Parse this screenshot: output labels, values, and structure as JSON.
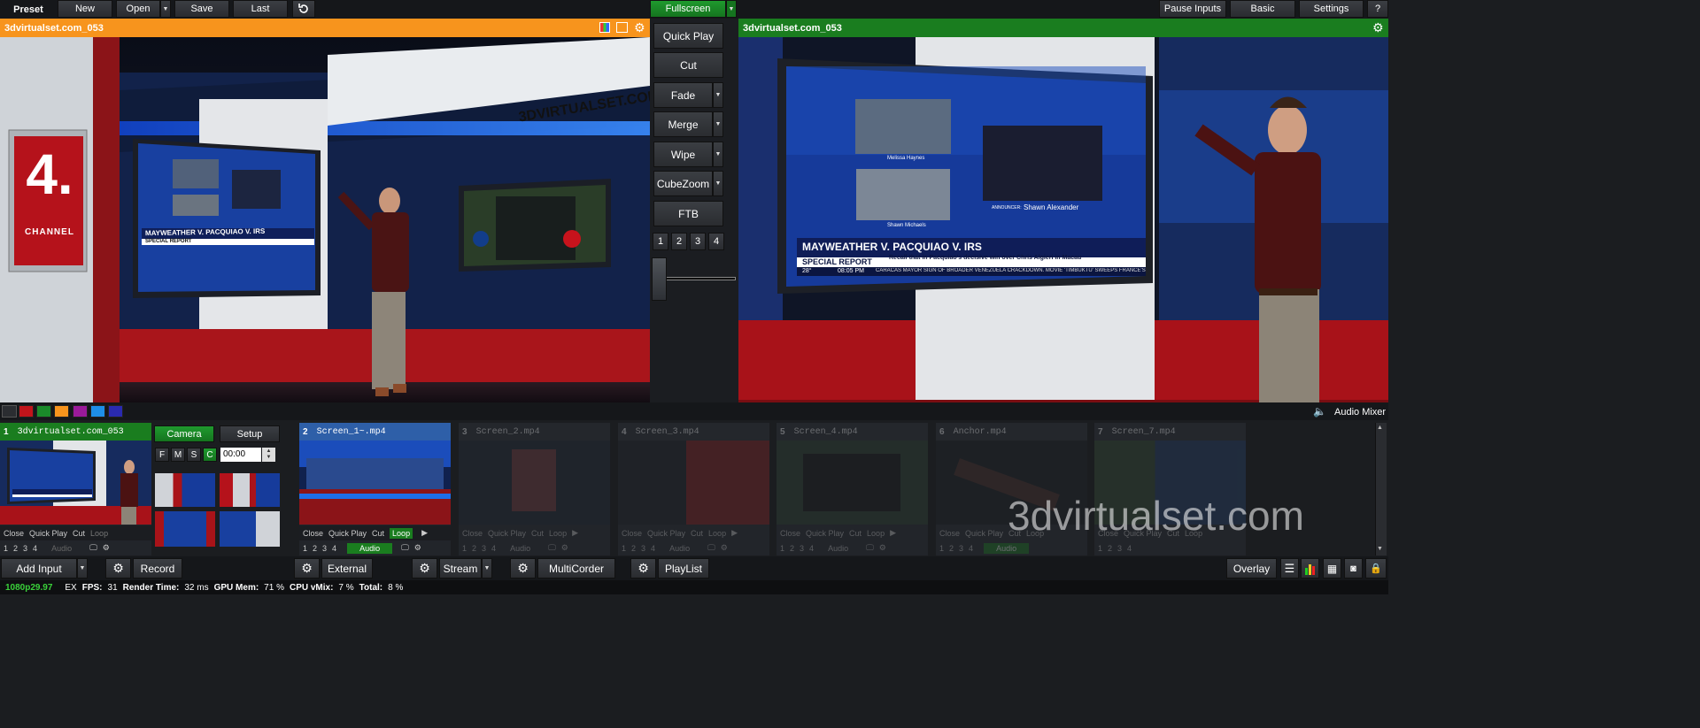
{
  "toolbar": {
    "preset_label": "Preset",
    "new_label": "New",
    "open_label": "Open",
    "save_label": "Save",
    "last_label": "Last",
    "fullscreen_label": "Fullscreen",
    "pause_inputs_label": "Pause Inputs",
    "basic_label": "Basic",
    "settings_label": "Settings",
    "help_label": "?"
  },
  "preview": {
    "title": "3dvirtualset.com_053",
    "header_color": "#f7941d",
    "brand_text": "3DVIRTUALSET.COM",
    "channel_number": "4.",
    "channel_word": "CHANNEL",
    "lower_third": "MAYWEATHER V. PACQUIAO V. IRS",
    "special_report": "SPECIAL REPORT"
  },
  "program": {
    "title": "3dvirtualset.com_053",
    "header_color": "#1a7d1f",
    "headline": "MAYWEATHER V. PACQUIAO V. IRS",
    "special_report": "SPECIAL REPORT",
    "ticker_main": "Recall that in Pacquiao's decisive win over Chris Algieri in Macau",
    "ticker_small": "CARACAS MAYOR SIGN OF BROADER VENEZUELA CRACKDOWN.   MOVIE 'TIMBUKTU' SWEEPS FRANCE'S CESAR AWARDS",
    "temp": "28°",
    "time": "08:05 PM",
    "reporter1": "Melissa Haynes",
    "reporter2": "Shawn Michaels",
    "announcer": "Shawn Alexander",
    "announcer_prefix": "ANNOUNCER:"
  },
  "transitions": {
    "quick_play": "Quick Play",
    "cut": "Cut",
    "fade": "Fade",
    "merge": "Merge",
    "wipe": "Wipe",
    "cubezoom": "CubeZoom",
    "ftb": "FTB",
    "numbers": [
      "1",
      "2",
      "3",
      "4"
    ]
  },
  "colors": {
    "swatches": [
      "#c1141b",
      "#1a8a2a",
      "#f7941d",
      "#9a1a9a",
      "#1e8ee8",
      "#2a2ab0"
    ]
  },
  "audio_mixer_label": "Audio Mixer",
  "inputs": [
    {
      "num": "1",
      "name": "3dvirtualset.com_053",
      "state": "program"
    },
    {
      "num": "2",
      "name": "Screen_1~.mp4",
      "state": "preview"
    },
    {
      "num": "3",
      "name": "Screen_2.mp4",
      "state": "idle"
    },
    {
      "num": "4",
      "name": "Screen_3.mp4",
      "state": "idle"
    },
    {
      "num": "5",
      "name": "Screen_4.mp4",
      "state": "idle"
    },
    {
      "num": "6",
      "name": "Anchor.mp4",
      "state": "idle"
    },
    {
      "num": "7",
      "name": "Screen_7.mp4",
      "state": "idle"
    }
  ],
  "input_controls": {
    "close": "Close",
    "quick_play": "Quick Play",
    "cut": "Cut",
    "loop": "Loop",
    "audio": "Audio",
    "nums": [
      "1",
      "2",
      "3",
      "4"
    ]
  },
  "camera_panel": {
    "camera_label": "Camera",
    "setup_label": "Setup",
    "flags": [
      "F",
      "M",
      "S",
      "C"
    ],
    "timecode": "00:00"
  },
  "watermark": "3dvirtualset.com",
  "bottom": {
    "add_input": "Add Input",
    "record": "Record",
    "external": "External",
    "stream": "Stream",
    "multicorder": "MultiCorder",
    "playlist": "PlayList",
    "overlay": "Overlay"
  },
  "status": {
    "format": "1080p29.97",
    "ex": "EX",
    "fps_label": "FPS:",
    "fps": "31",
    "render_label": "Render Time:",
    "render": "32 ms",
    "gpu_label": "GPU Mem:",
    "gpu": "71 %",
    "cpu_label": "CPU vMix:",
    "cpu": "7 %",
    "total_label": "Total:",
    "total": "8 %"
  }
}
